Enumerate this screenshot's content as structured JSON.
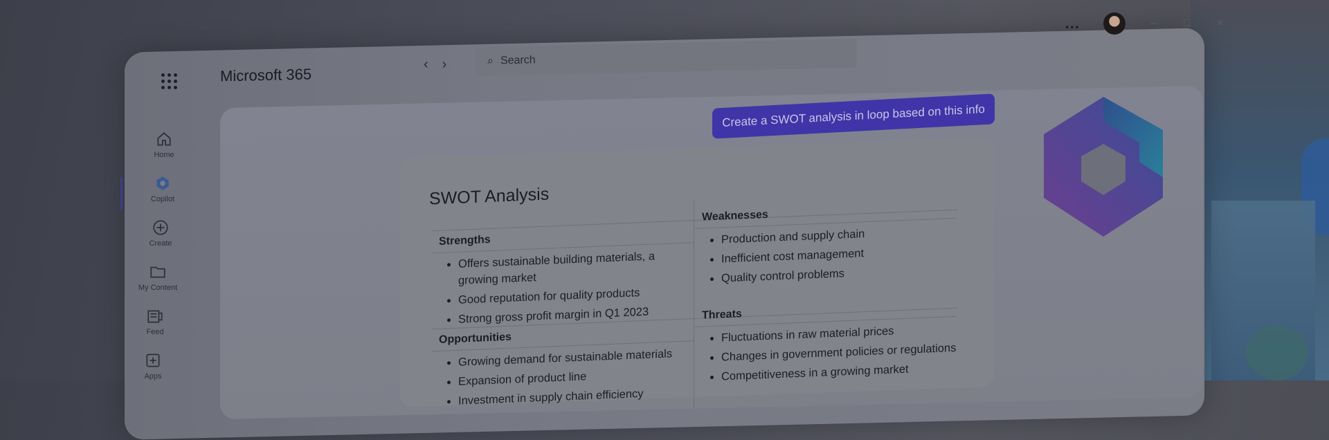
{
  "app": {
    "title": "Microsoft 365"
  },
  "search": {
    "placeholder": "Search"
  },
  "topbar": {
    "more_label": "...",
    "minimize_label": "–",
    "maximize_label": "□",
    "close_label": "×"
  },
  "nav": [
    {
      "label": "Home",
      "icon": "home-icon"
    },
    {
      "label": "Copilot",
      "icon": "copilot-icon"
    },
    {
      "label": "Create",
      "icon": "plus-circle-icon"
    },
    {
      "label": "My Content",
      "icon": "folder-icon"
    },
    {
      "label": "Feed",
      "icon": "feed-icon"
    },
    {
      "label": "Apps",
      "icon": "apps-icon"
    }
  ],
  "chat": {
    "prompt": "Create a SWOT analysis in loop based on this info"
  },
  "swot": {
    "title": "SWOT Analysis",
    "strengths": {
      "heading": "Strengths",
      "items": [
        "Offers sustainable building materials, a growing market",
        "Good reputation for quality products",
        "Strong gross profit margin in Q1 2023"
      ]
    },
    "weaknesses": {
      "heading": "Weaknesses",
      "items": [
        "Production and supply chain",
        "Inefficient cost management",
        "Quality control problems"
      ]
    },
    "opportunities": {
      "heading": "Opportunities",
      "items": [
        "Growing demand for sustainable materials",
        "Expansion of product line",
        "Investment in supply chain efficiency"
      ]
    },
    "threats": {
      "heading": "Threats",
      "items": [
        "Fluctuations in raw material prices",
        "Changes in government policies or regulations",
        "Competitiveness in a growing market"
      ]
    }
  },
  "colors": {
    "accent": "#3f35a8",
    "background": "#4a4c58"
  }
}
